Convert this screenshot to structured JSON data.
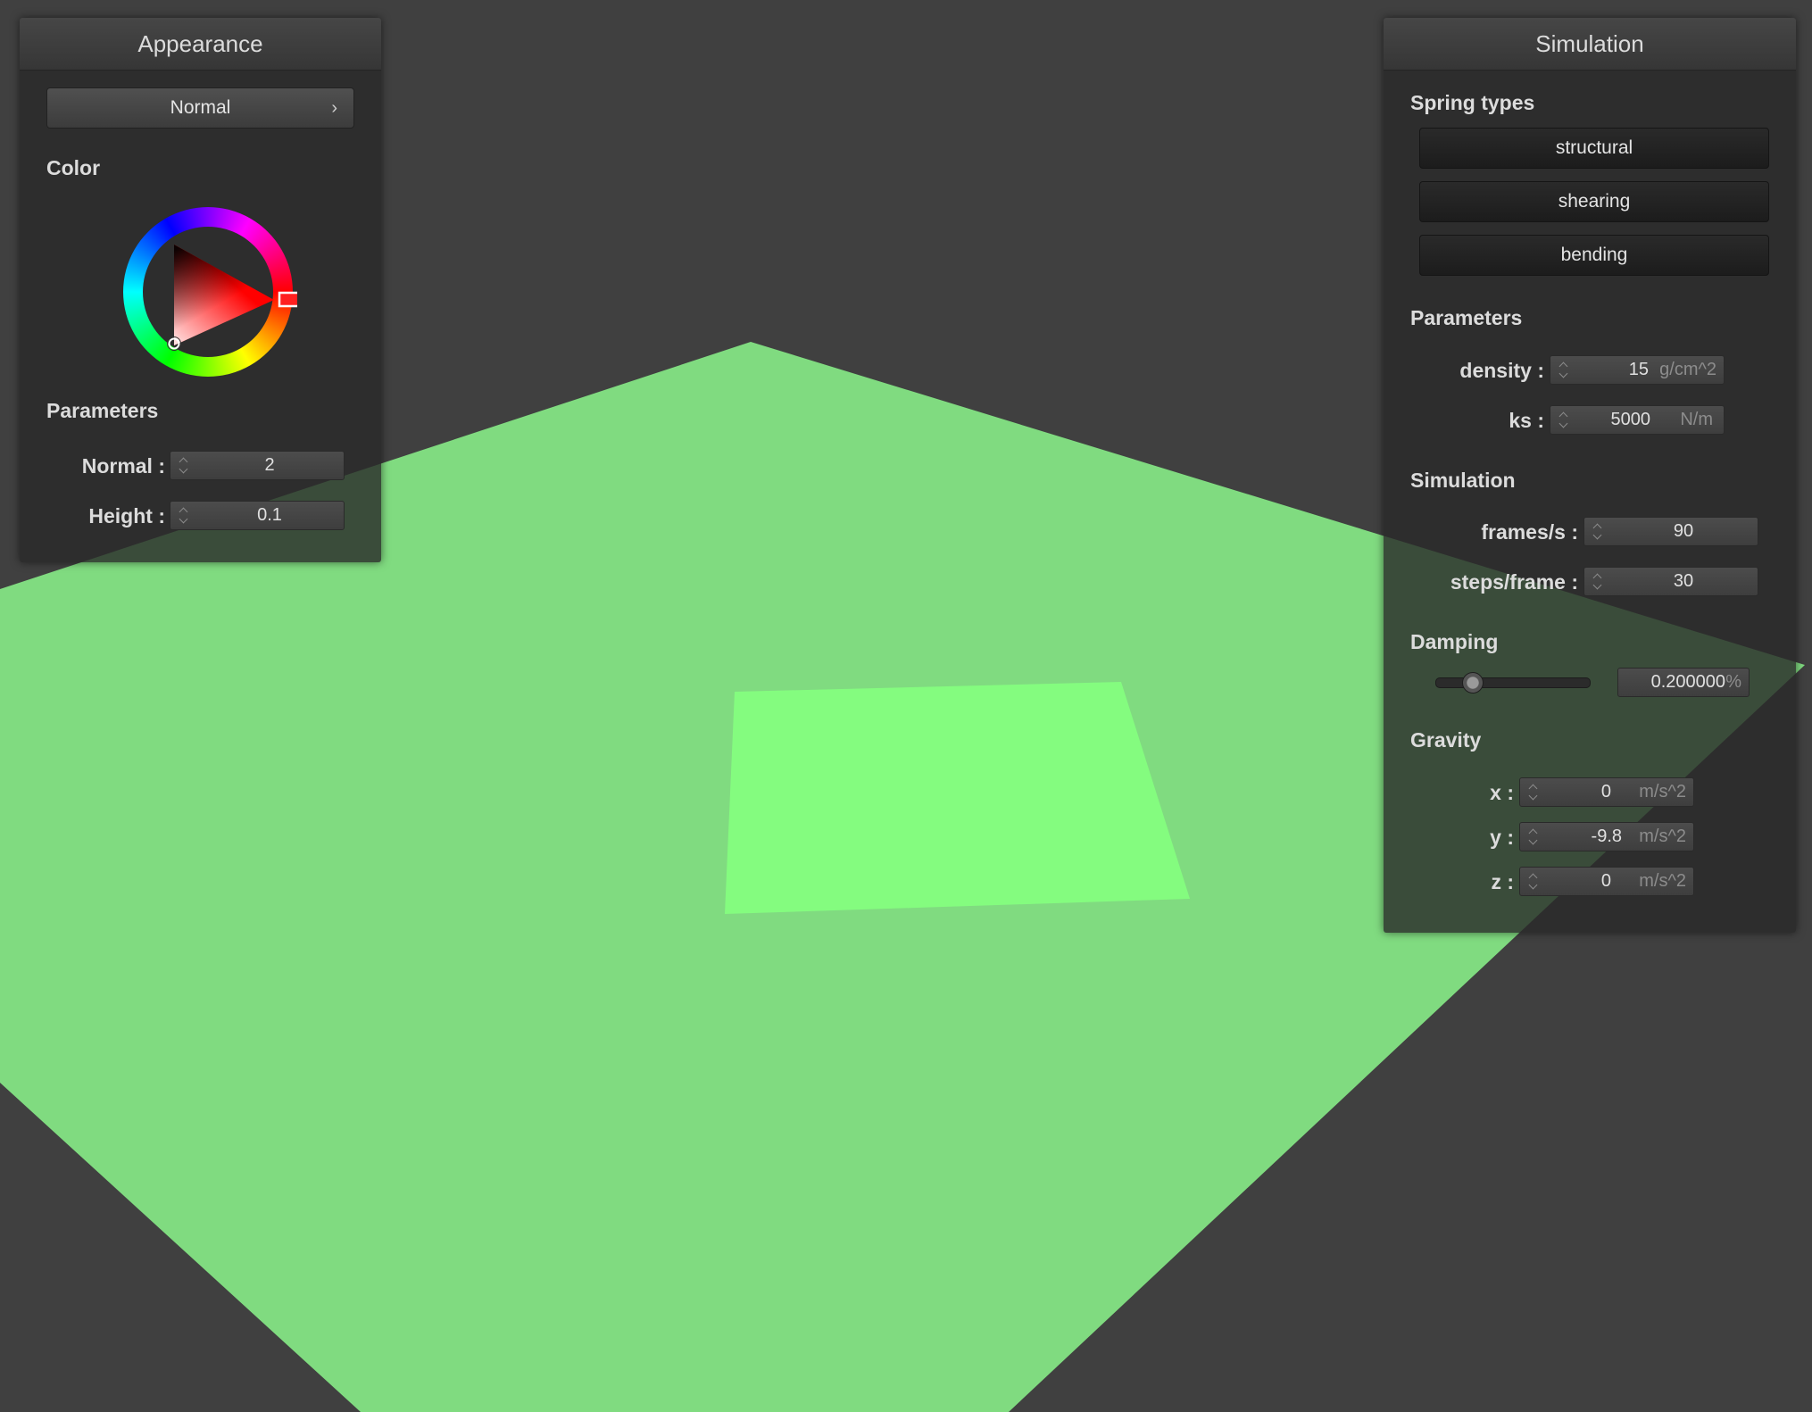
{
  "scene": {
    "background": "#404040",
    "cloth_color": "#80db80",
    "highlight_color": "#84fc7f"
  },
  "appearance": {
    "title": "Appearance",
    "shader_select": "Normal",
    "color_label": "Color",
    "selected_color": "#ff0000",
    "parameters_label": "Parameters",
    "normal_label": "Normal :",
    "normal_value": "2",
    "height_label": "Height :",
    "height_value": "0.1"
  },
  "simulation": {
    "title": "Simulation",
    "spring_types_label": "Spring types",
    "spring_buttons": [
      "structural",
      "shearing",
      "bending"
    ],
    "parameters_label": "Parameters",
    "density_label": "density :",
    "density_value": "15",
    "density_unit": "g/cm^2",
    "ks_label": "ks :",
    "ks_value": "5000",
    "ks_unit": "N/m",
    "simulation_label": "Simulation",
    "fps_label": "frames/s :",
    "fps_value": "90",
    "steps_label": "steps/frame :",
    "steps_value": "30",
    "damping_label": "Damping",
    "damping_value": "0.200000",
    "damping_unit": "%",
    "damping_fraction": 0.2,
    "gravity_label": "Gravity",
    "gravity": [
      {
        "label": "x :",
        "value": "0",
        "unit": "m/s^2"
      },
      {
        "label": "y :",
        "value": "-9.8",
        "unit": "m/s^2"
      },
      {
        "label": "z :",
        "value": "0",
        "unit": "m/s^2"
      }
    ]
  }
}
